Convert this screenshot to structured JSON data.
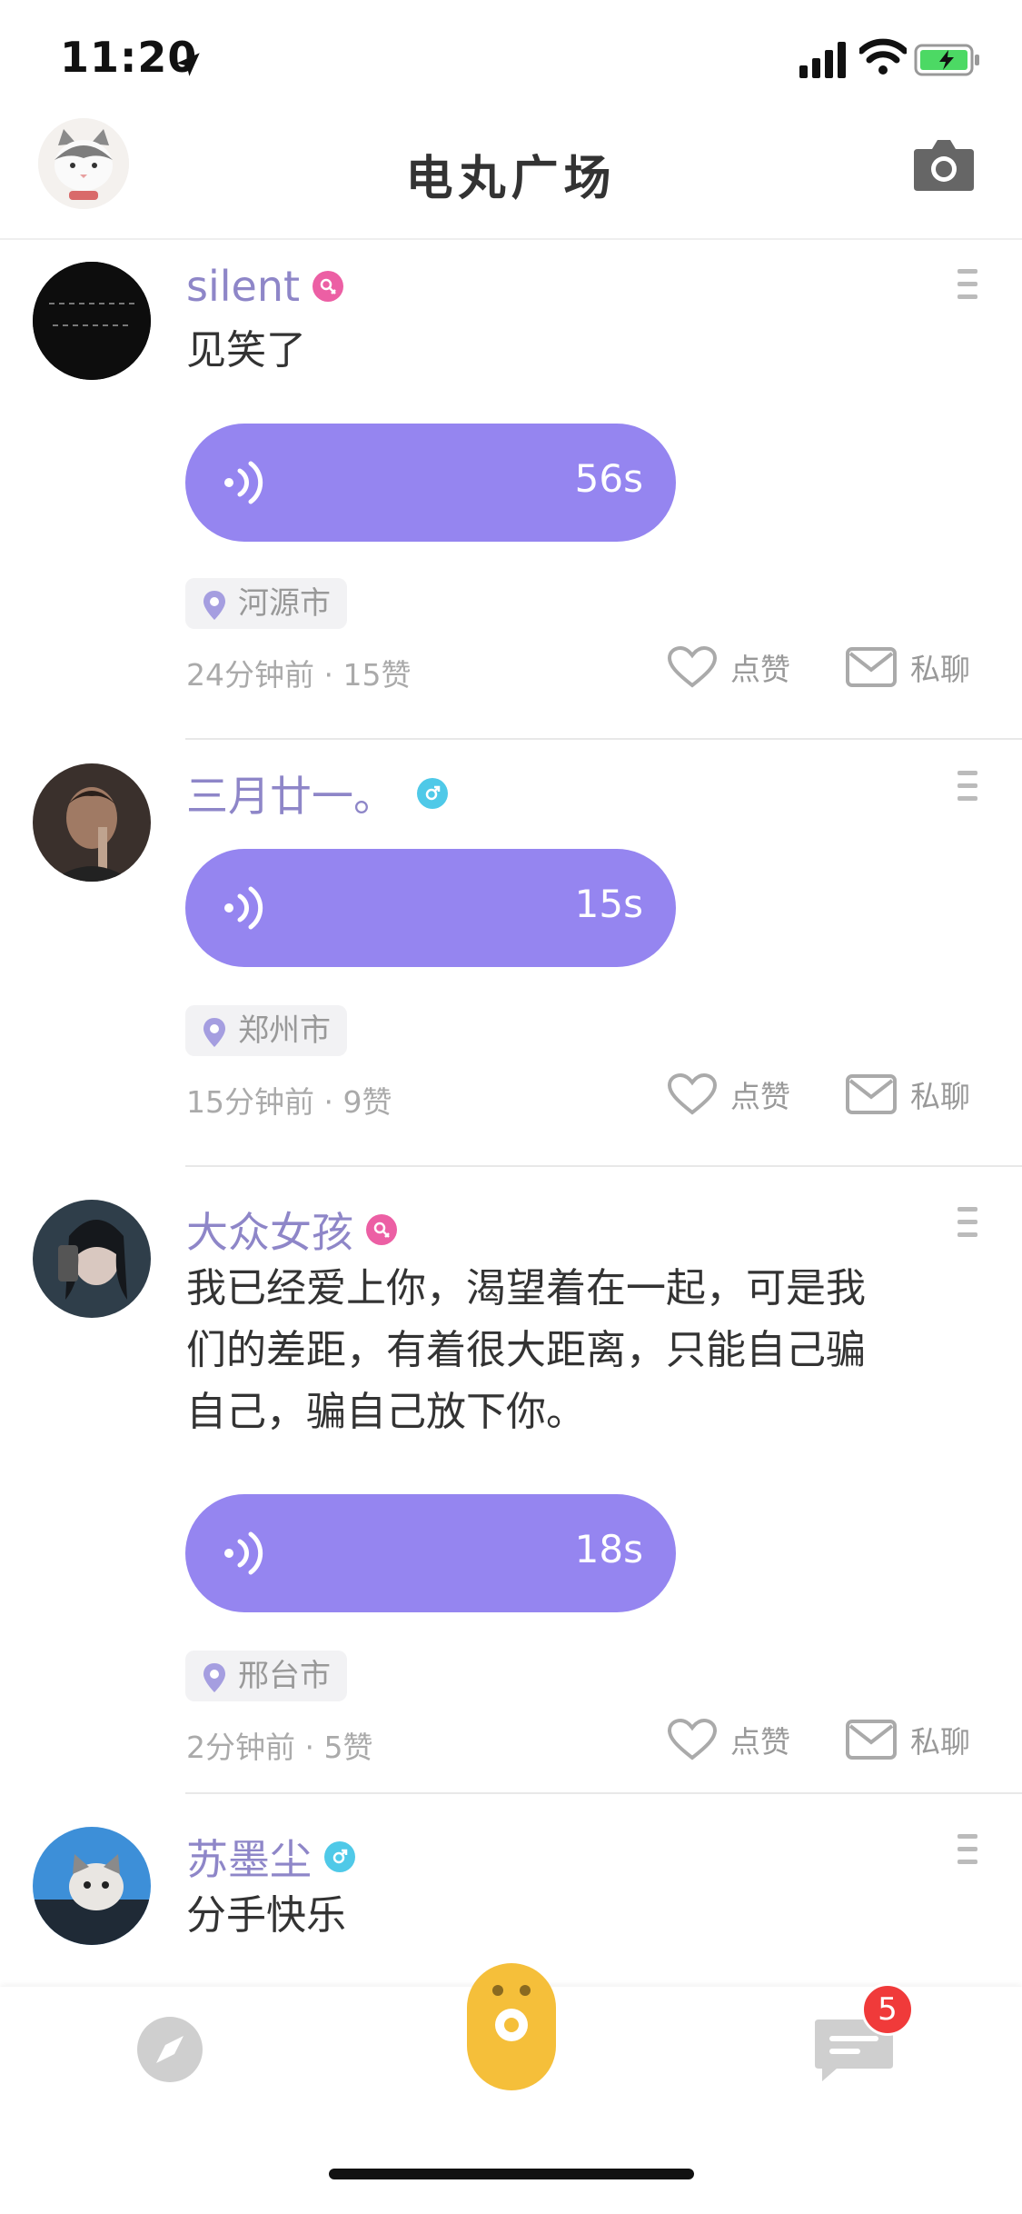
{
  "status_bar": {
    "time": "11:20"
  },
  "header": {
    "title": "电丸广场"
  },
  "feed": {
    "like_label": "点赞",
    "chat_label": "私聊",
    "posts": [
      {
        "username": "silent",
        "gender": "female",
        "text": "见笑了",
        "duration": "56s",
        "location": "河源市",
        "time_ago": "24分钟前",
        "likes": "15赞"
      },
      {
        "username": "三月廿一。",
        "gender": "male",
        "text": "",
        "duration": "15s",
        "location": "郑州市",
        "time_ago": "15分钟前",
        "likes": "9赞"
      },
      {
        "username": "大众女孩",
        "gender": "female",
        "text": "我已经爱上你，渴望着在一起，可是我们的差距，有着很大距离，只能自己骗自己，骗自己放下你。",
        "duration": "18s",
        "location": "邢台市",
        "time_ago": "2分钟前",
        "likes": "5赞"
      },
      {
        "username": "苏墨尘",
        "gender": "male",
        "text": "分手快乐"
      }
    ]
  },
  "tabbar": {
    "message_badge": "5"
  },
  "colors": {
    "accent_purple": "#9585f0",
    "username": "#8e86c8",
    "female": "#ec5fa4",
    "male": "#4fc9e8",
    "center_tab": "#f5bf3a",
    "badge": "#f03a3a"
  },
  "icons": [
    "location-arrow-icon",
    "signal-icon",
    "wifi-icon",
    "battery-icon",
    "camera-icon",
    "more-icon",
    "voice-wave-icon",
    "location-pin-icon",
    "heart-icon",
    "envelope-icon",
    "compass-icon",
    "message-icon"
  ]
}
